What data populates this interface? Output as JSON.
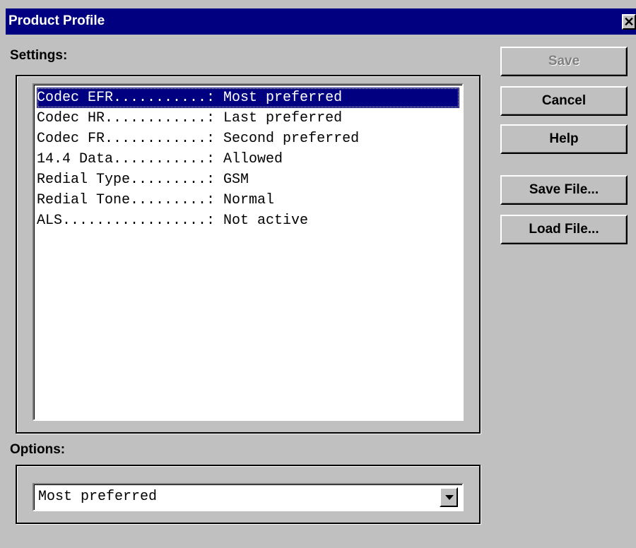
{
  "window": {
    "title": "Product Profile",
    "close_glyph": "✕"
  },
  "settings": {
    "label": "Settings:",
    "rows": [
      {
        "text": "Codec EFR...........: Most preferred",
        "selected": true
      },
      {
        "text": "Codec HR............: Last preferred",
        "selected": false
      },
      {
        "text": "Codec FR............: Second preferred",
        "selected": false
      },
      {
        "text": "14.4 Data...........: Allowed",
        "selected": false
      },
      {
        "text": "Redial Type.........: GSM",
        "selected": false
      },
      {
        "text": "Redial Tone.........: Normal",
        "selected": false
      },
      {
        "text": "ALS.................: Not active",
        "selected": false
      }
    ]
  },
  "options": {
    "label": "Options:",
    "value": "Most preferred"
  },
  "buttons": {
    "save": "Save",
    "cancel": "Cancel",
    "help": "Help",
    "save_file": "Save File...",
    "load_file": "Load File..."
  },
  "colors": {
    "titlebar": "#000080",
    "face": "#c0c0c0",
    "selection": "#000080"
  }
}
